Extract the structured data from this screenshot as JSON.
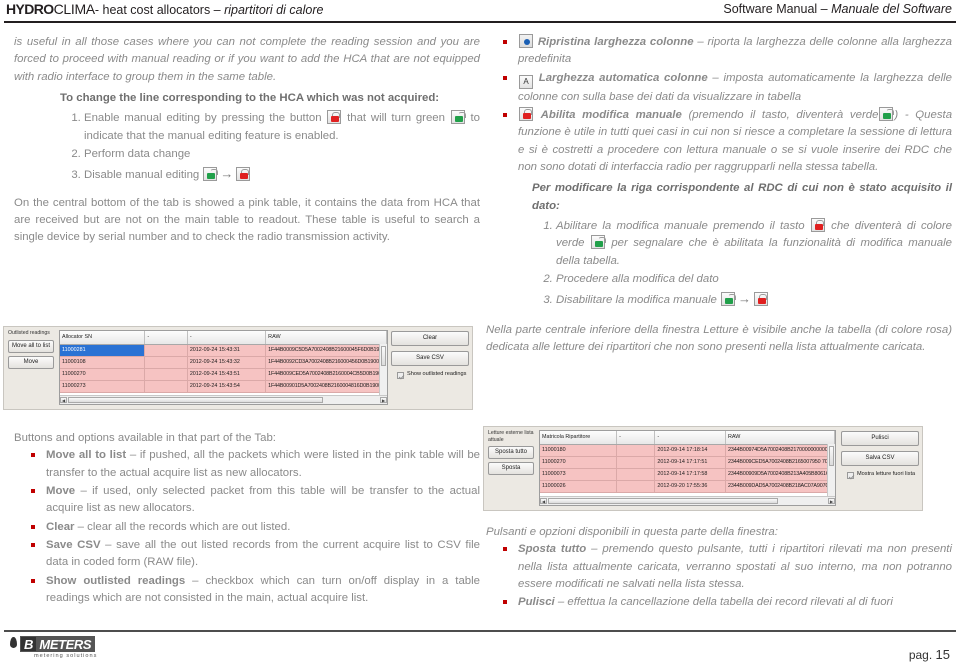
{
  "header": {
    "brand_hydro": "HYDRO",
    "brand_clima": "CLIMA",
    "brand_tail": "- heat cost allocators – ",
    "brand_tail_italic": "ripartitori di calore",
    "right_plain": "Software Manual – ",
    "right_italic": "Manuale del Software"
  },
  "left": {
    "intro": "is useful in all those cases where you can not complete the reading session and you are forced to proceed with manual reading or if you want to add the HCA that are not equipped with radio interface to group them in the same table.",
    "howto_title": "To change the line corresponding to the HCA which was not acquired:",
    "step1_a": "Enable manual editing by pressing the button",
    "step1_b": "that will turn green",
    "step1_c": "to indicate that the manual editing feature is enabled.",
    "step2": "Perform data change",
    "step3": "Disable manual editing",
    "para2": "On the central bottom of the tab is  showed a pink table, it contains the data from HCA that are received but are not on the main table to readout. These table is useful to search a single device by serial number and to check the radio transmission activity.",
    "buttons_intro": "Buttons and options available in that part of the Tab:",
    "bullets": [
      {
        "label": "Move all to list",
        "text": " – if pushed, all the packets which were listed in the pink table will be transfer to the actual acquire list as new allocators."
      },
      {
        "label": "Move",
        "text": " – if used, only selected packet from this table will be transfer to the actual acquire list as new allocators."
      },
      {
        "label": "Clear",
        "text": " – clear all the records which are out listed."
      },
      {
        "label": "Save CSV",
        "text": " – save all the out listed records from the current acquire list to CSV file  data in coded form (RAW file)."
      },
      {
        "label": "Show outlisted readings",
        "text": " – checkbox which can turn on/off display in a table readings which are not consisted in the main, actual acquire list."
      }
    ]
  },
  "right": {
    "bullet1_label": "Ripristina larghezza colonne",
    "bullet1_text": " – riporta la larghezza delle colonne alla larghezza predefinita",
    "bullet2_label": "Larghezza automatica colonne",
    "bullet2_text": " – imposta automaticamente la larghezza delle colonne con sulla base dei dati da visualizzare in tabella",
    "bullet3_label": "Abilita modifica manuale",
    "bullet3_a": "(premendo il tasto, diventerà verde",
    "bullet3_b": ") - Questa funzione è utile in tutti quei casi in cui non si riesce a completare la sessione di lettura e si è costretti a procedere con lettura manuale o se si vuole inserire dei RDC che non sono dotati di interfaccia radio per raggrupparli nella stessa tabella.",
    "howto_title": "Per modificare la riga corrispondente al RDC di cui non è stato acquisito il dato:",
    "step1_a": "Abilitare la modifica manuale premendo il tasto",
    "step1_b": "che diventerà di colore verde",
    "step1_c": "per segnalare che è abilitata la funzionalità di modifica manuale della tabella.",
    "step2": "Procedere alla modifica del dato",
    "step3": "Disabilitare la modifica manuale",
    "para2": "Nella parte centrale inferiore della finestra Letture è visibile anche la tabella (di colore rosa) dedicata alle letture dei ripartitori che non sono presenti nella lista attualmente caricata.",
    "buttons_intro": "Pulsanti e opzioni disponibili in questa parte della finestra:",
    "bullets": [
      {
        "label": "Sposta tutto",
        "text": " – premendo questo pulsante, tutti i ripartitori rilevati ma non presenti nella lista attualmente caricata, verranno spostati al suo interno, ma non potranno essere modificati ne salvati nella lista stessa."
      },
      {
        "label": "Pulisci",
        "text": " – effettua la cancellazione della tabella dei record rilevati al di fuori"
      }
    ]
  },
  "screenshot_en": {
    "side_label": "Outlisted readings",
    "btn_move_all": "Move all to list",
    "btn_move": "Move",
    "columns": [
      "Allocator SN",
      "-",
      "-",
      "RAW"
    ],
    "rows": [
      {
        "sn": "11000281",
        "blank": "",
        "datetime": "2012-09-24 15:43:31",
        "raw": "1F44B0009C5D5A7002408B21600045F6D0B19000000000",
        "selected": true
      },
      {
        "sn": "11000108",
        "blank": "",
        "datetime": "2012-09-24 15:43:32",
        "raw": "1F44B0092CD3A7002408B216000456D0B19000000000",
        "selected": false
      },
      {
        "sn": "11000270",
        "blank": "",
        "datetime": "2012-09-24 15:43:51",
        "raw": "1F44B009CED5A7002408B2160004CB5D0B19000000000",
        "selected": false
      },
      {
        "sn": "11000273",
        "blank": "",
        "datetime": "2012-09-24 15:43:54",
        "raw": "1F44B00901D5A7002408B2160004816D0B19000000000",
        "selected": false
      }
    ],
    "btn_clear": "Clear",
    "btn_save_csv": "Save CSV",
    "checkbox_label": "Show outlisted readings",
    "checkbox_checked": true
  },
  "screenshot_it": {
    "side_label": "Letture esterne lista attuale",
    "btn_move_all": "Sposta tutto",
    "btn_move": "Sposta",
    "columns": [
      "Matricola Ripartitore",
      "-",
      "-",
      "RAW"
    ],
    "rows": [
      {
        "sn": "11000180",
        "blank": "",
        "datetime": "2012-09-14 17:18:14",
        "raw": "2344B00974D5A7002408B21700000000000000000000",
        "selected": false
      },
      {
        "sn": "11000270",
        "blank": "",
        "datetime": "2012-09-14 17:17:51",
        "raw": "2344B009CED5A7002408B2165007950 7CE070000000000",
        "selected": false
      },
      {
        "sn": "11000073",
        "blank": "",
        "datetime": "2012-09-14 17:17:58",
        "raw": "2344B00909D5A7002408B213A405B8061C07000000000",
        "selected": false
      },
      {
        "sn": "11000026",
        "blank": "",
        "datetime": "2012-09-20 17:55:36",
        "raw": "2344B009DAD5A7002408B218AC07A907C00700000000",
        "selected": false
      }
    ],
    "btn_clear": "Pulisci",
    "btn_save_csv": "Salva CSV",
    "checkbox_label": "Mostra letture fuori lista",
    "checkbox_checked": true
  },
  "footer": {
    "logo_b": "B",
    "logo_meters": "METERS",
    "logo_tagline": "metering solutions",
    "page_prefix": "pag. ",
    "page_number": "15"
  },
  "colors": {
    "accent_red": "#c00000",
    "table_pink": "#f6c3c2",
    "selection_blue": "#2a72d4",
    "text_gray": "#8a8a8a"
  }
}
